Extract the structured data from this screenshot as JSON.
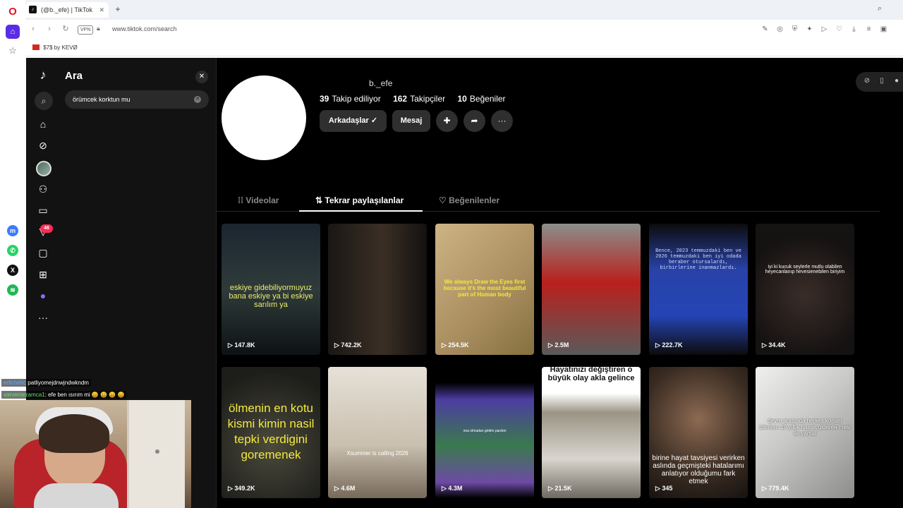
{
  "browser": {
    "tab_title": "(@b._efe) | TikTok",
    "tab_icon": "♪",
    "vpn_label": "VPN",
    "url": "www.tiktok.com/search",
    "bookmark_label": "$7$ by KEVØ"
  },
  "search_panel": {
    "title": "Ara",
    "query": "örümcek korktun mu"
  },
  "notifications": {
    "count": "46"
  },
  "profile": {
    "username": "b._efe",
    "following_count": "39",
    "following_label": "Takip ediliyor",
    "followers_count": "162",
    "followers_label": "Takipçiler",
    "likes_count": "10",
    "likes_label": "Beğeniler",
    "friends_button": "Arkadaşlar ✓",
    "message_button": "Mesaj",
    "more_glyph": "···"
  },
  "tabs": [
    {
      "label": "Videolar",
      "icon": "grid-icon"
    },
    {
      "label": "Tekrar paylaşılanlar",
      "icon": "repost-icon"
    },
    {
      "label": "Beğenilenler",
      "icon": "heart-icon"
    }
  ],
  "videos": [
    {
      "views": "147.8K",
      "caption": "eskiye gidebiliyormuyuz bana eskiye ya bi eskiye sarılım ya"
    },
    {
      "views": "742.2K",
      "caption": ""
    },
    {
      "views": "254.5K",
      "caption": "We always Draw the Eyes first because it's the most beautiful part of Human body"
    },
    {
      "views": "2.5M",
      "caption": ""
    },
    {
      "views": "222.7K",
      "caption": "Bence, 2023 temmuzdaki ben ve 2026 temmuzdaki ben iyi odada beraber otursalardı, birbirlerine inanmazlardı."
    },
    {
      "views": "34.4K",
      "caption": "iyi ki kucuk seylerle mutlu olabilen heyecanlanıp hevesienebilen biriyim"
    },
    {
      "views": "349.2K",
      "caption": "ölmenin en kotu kismi kimin nasil tepki verdigini goremenek"
    },
    {
      "views": "4.6M",
      "caption": "Xsummer is calling 2026"
    },
    {
      "views": "4.3M",
      "caption": "ona olmadan girdim pardon"
    },
    {
      "views": "21.5K",
      "caption": "Hayatınızı değiştiren o büyük olay akla gelince"
    },
    {
      "views": "345",
      "caption": "birine hayat tavsiyesi verirken aslında geçmişteki hatalarımı anlatıyor olduğumu fark etmek"
    },
    {
      "views": "779.4K",
      "caption": "devre arasında herkes konser izlerken 19 yıllık hasret giderен mesi ile yamal"
    }
  ],
  "chat": [
    {
      "user": "erlichetk",
      "text": ": patliyomejdnwjndwkndm"
    },
    {
      "user": "varvemezamca1",
      "text": ": efe ben ısırım mi 😄 😄 😄 😄"
    }
  ],
  "colors": {
    "tiktok_bg": "#000000",
    "panel_bg": "#121212",
    "badge": "#fe2c55",
    "opera_red": "#e0141e",
    "opera_purple": "#5b2ce4"
  }
}
